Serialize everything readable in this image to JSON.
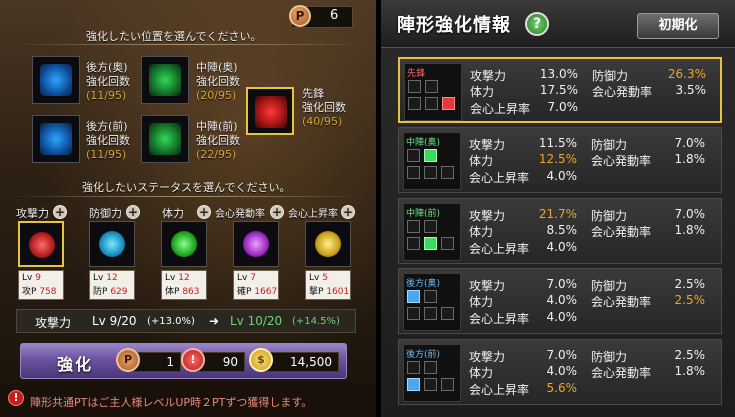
{
  "left": {
    "points": {
      "icon": "P",
      "value": "6"
    },
    "hint_position": "強化したい位置を選んでください。",
    "slots": [
      {
        "label1": "後方(奥)",
        "label2": "強化回数",
        "count": "(11/95)",
        "color": "blue"
      },
      {
        "label1": "中陣(奥)",
        "label2": "強化回数",
        "count": "(20/95)",
        "color": "green"
      },
      {
        "label1": "後方(前)",
        "label2": "強化回数",
        "count": "(11/95)",
        "color": "blue"
      },
      {
        "label1": "中陣(前)",
        "label2": "強化回数",
        "count": "(22/95)",
        "color": "green"
      },
      {
        "label1": "先鋒",
        "label2": "強化回数",
        "count": "(40/95)",
        "color": "red"
      }
    ],
    "hint_status": "強化したいステータスを選んでください。",
    "stats": [
      {
        "label": "攻撃力",
        "lv_label": "Lv",
        "lv": "9",
        "p_label": "攻P",
        "p": "758"
      },
      {
        "label": "防御力",
        "lv_label": "Lv",
        "lv": "12",
        "p_label": "防P",
        "p": "629"
      },
      {
        "label": "体力",
        "lv_label": "Lv",
        "lv": "12",
        "p_label": "体P",
        "p": "863"
      },
      {
        "label": "会心発動率",
        "lv_label": "Lv",
        "lv": "7",
        "p_label": "確P",
        "p": "1667"
      },
      {
        "label": "会心上昇率",
        "lv_label": "Lv",
        "lv": "5",
        "p_label": "撃P",
        "p": "1601"
      }
    ],
    "levelbar": {
      "name": "攻撃力",
      "cur": "Lv 9/20",
      "cur_pct": "(+13.0%)",
      "arrow": "➜",
      "next": "Lv 10/20",
      "next_pct": "(+14.5%)"
    },
    "enhance": {
      "label": "強化",
      "cost_p": "1",
      "cost_atk": "90",
      "cost_gold": "14,500"
    },
    "note": "陣形共通PTはご主人様レベルUP時２PTずつ獲得します。",
    "colors": {
      "highlight": "#e7c43f",
      "orange": "#f0a52a",
      "green_text": "#6fd46f"
    }
  },
  "right": {
    "title": "陣形強化情報",
    "help_icon": "?",
    "reset_label": "初期化",
    "cards": [
      {
        "name": "先鋒",
        "atk_label": "攻撃力",
        "atk": "13.0%",
        "def_label": "防御力",
        "def": "26.3%",
        "hp_label": "体力",
        "hp": "17.5%",
        "crit_label": "会心発動率",
        "crit": "3.5%",
        "critup_label": "会心上昇率",
        "critup": "7.0%"
      },
      {
        "name": "中陣(奥)",
        "atk_label": "攻撃力",
        "atk": "11.5%",
        "def_label": "防御力",
        "def": "7.0%",
        "hp_label": "体力",
        "hp": "12.5%",
        "crit_label": "会心発動率",
        "crit": "1.8%",
        "critup_label": "会心上昇率",
        "critup": "4.0%"
      },
      {
        "name": "中陣(前)",
        "atk_label": "攻撃力",
        "atk": "21.7%",
        "def_label": "防御力",
        "def": "7.0%",
        "hp_label": "体力",
        "hp": "8.5%",
        "crit_label": "会心発動率",
        "crit": "1.8%",
        "critup_label": "会心上昇率",
        "critup": "4.0%"
      },
      {
        "name": "後方(奥)",
        "atk_label": "攻撃力",
        "atk": "7.0%",
        "def_label": "防御力",
        "def": "2.5%",
        "hp_label": "体力",
        "hp": "4.0%",
        "crit_label": "会心発動率",
        "crit": "2.5%",
        "critup_label": "会心上昇率",
        "critup": "4.0%"
      },
      {
        "name": "後方(前)",
        "atk_label": "攻撃力",
        "atk": "7.0%",
        "def_label": "防御力",
        "def": "2.5%",
        "hp_label": "体力",
        "hp": "4.0%",
        "crit_label": "会心発動率",
        "crit": "1.8%",
        "critup_label": "会心上昇率",
        "critup": "5.6%"
      }
    ]
  }
}
